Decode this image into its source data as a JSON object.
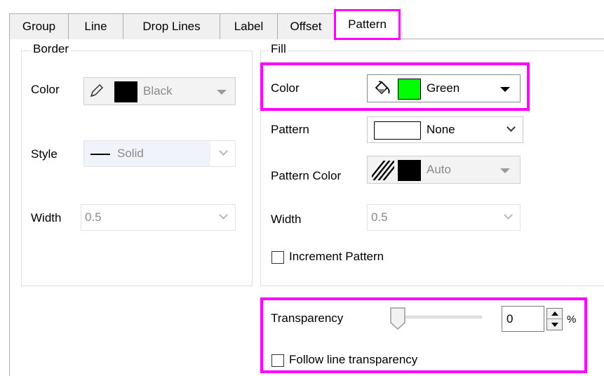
{
  "tabs": [
    {
      "label": "Group"
    },
    {
      "label": "Line"
    },
    {
      "label": "Drop Lines"
    },
    {
      "label": "Label"
    },
    {
      "label": "Offset"
    },
    {
      "label": "Pattern",
      "active": true
    }
  ],
  "border": {
    "title": "Border",
    "color_label": "Color",
    "color_value": "Black",
    "color_swatch": "#000000",
    "style_label": "Style",
    "style_value": "Solid",
    "width_label": "Width",
    "width_value": "0.5"
  },
  "fill": {
    "title": "Fill",
    "color_label": "Color",
    "color_value": "Green",
    "color_swatch": "#00ff00",
    "pattern_label": "Pattern",
    "pattern_value": "None",
    "pattern_color_label": "Pattern Color",
    "pattern_color_value": "Auto",
    "pattern_color_swatch": "#000000",
    "width_label": "Width",
    "width_value": "0.5",
    "increment_label": "Increment Pattern",
    "increment_checked": false
  },
  "transparency": {
    "label": "Transparency",
    "value": "0",
    "unit": "%",
    "slider_fraction": 0,
    "follow_label": "Follow line transparency",
    "follow_checked": false
  },
  "colors": {
    "highlight": "#ff00ff",
    "disabled_text": "#8a8a8a"
  }
}
